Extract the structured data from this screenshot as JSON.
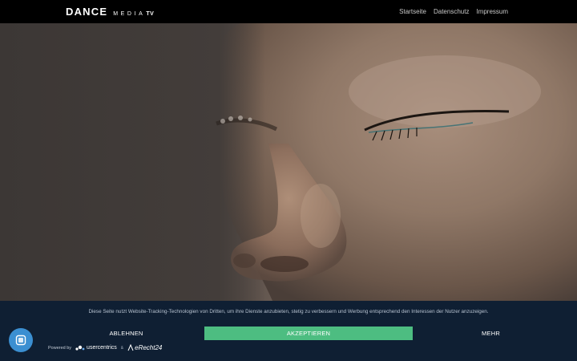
{
  "header": {
    "logo": {
      "main": "DANCE",
      "sub": "MEDIA",
      "tv": "TV"
    },
    "nav": [
      {
        "label": "Startseite"
      },
      {
        "label": "Datenschutz"
      },
      {
        "label": "Impressum"
      }
    ]
  },
  "hero": {
    "icon": "close-up-face-photo"
  },
  "cookie": {
    "text": "Diese Seite nutzt Website-Tracking-Technologien von Dritten, um ihre Dienste anzubieten, stetig zu verbessern und Werbung entsprechend den Interessen der Nutzer anzuzeigen.",
    "decline_label": "ABLEHNEN",
    "accept_label": "AKZEPTIEREN",
    "more_label": "MEHR",
    "powered_by": "Powered by",
    "usercentrics": "usercentrics",
    "amp": "&",
    "erecht": "eRecht24",
    "accent": "#4dbd81",
    "background": "#0f1f33"
  },
  "floating_button": {
    "icon": "privacy-settings-icon",
    "color": "#3b8fd1"
  }
}
